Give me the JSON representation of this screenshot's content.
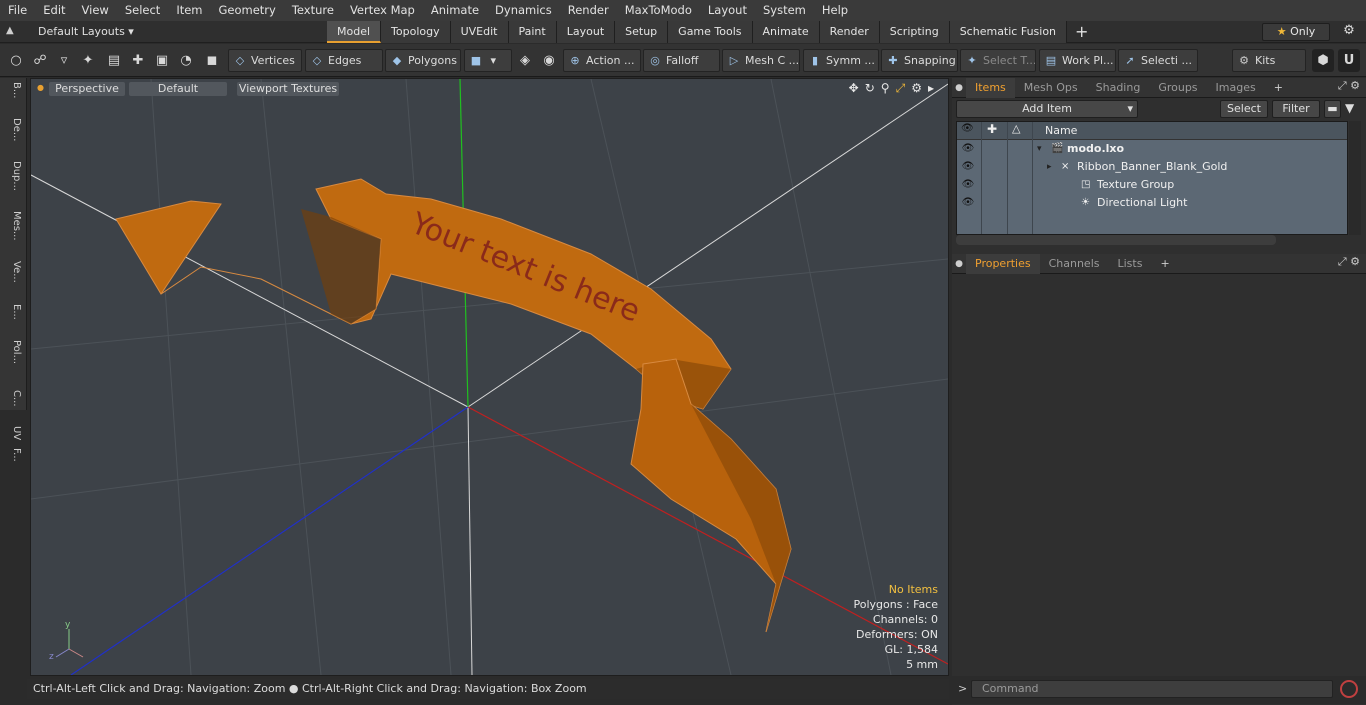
{
  "menu": [
    "File",
    "Edit",
    "View",
    "Select",
    "Item",
    "Geometry",
    "Texture",
    "Vertex Map",
    "Animate",
    "Dynamics",
    "Render",
    "MaxToModo",
    "Layout",
    "System",
    "Help"
  ],
  "layout": {
    "name": "Default Layouts ▾",
    "tabs": [
      "Model",
      "Topology",
      "UVEdit",
      "Paint",
      "Layout",
      "Setup",
      "Game Tools",
      "Animate",
      "Render",
      "Scripting",
      "Schematic Fusion"
    ],
    "active_tab": "Model",
    "plus": "+",
    "only_label": "Only"
  },
  "toolbar": {
    "vertices": "Vertices",
    "edges": "Edges",
    "polygons": "Polygons",
    "action": "Action",
    "falloff": "Falloff",
    "mesh": "Mesh C ...",
    "symm": "Symm ...",
    "snapping": "Snapping",
    "select_t": "Select T...",
    "work_pl": "Work Pl...",
    "selecti": "Selecti ...",
    "kits": "Kits"
  },
  "left_tabs": [
    "B...",
    "De...",
    "Dup...",
    "Mes...",
    "Ve...",
    "E...",
    "Pol...",
    "C...",
    "UV",
    "F..."
  ],
  "viewport": {
    "perspective": "Perspective",
    "default": "Default",
    "textures": "Viewport Textures",
    "banner_text": "Your text is here",
    "info": {
      "items": "No Items",
      "polygons": "Polygons : Face",
      "channels": "Channels: 0",
      "deformers": "Deformers: ON",
      "gl": "GL: 1,584",
      "scale": "5 mm"
    },
    "colors": {
      "ribbon": "#c06a10",
      "ribbon_dark": "#7a3f05",
      "text": "#8a2a1a",
      "axis_x": "#c02020",
      "axis_y": "#20c020",
      "axis_z": "#2020c0"
    }
  },
  "status": "Ctrl-Alt-Left Click and Drag: Navigation: Zoom ● Ctrl-Alt-Right Click and Drag: Navigation: Box Zoom",
  "items_panel": {
    "tabs": [
      "Items",
      "Mesh Ops",
      "Shading",
      "Groups",
      "Images"
    ],
    "active": "Items",
    "add_item": "Add Item",
    "select": "Select",
    "filter": "Filter",
    "name_header": "Name",
    "rows": [
      {
        "label": "modo.lxo",
        "arrow": "▾"
      },
      {
        "label": "Ribbon_Banner_Blank_Gold",
        "arrow": "▸"
      },
      {
        "label": "Texture Group",
        "arrow": ""
      },
      {
        "label": "Directional Light",
        "arrow": ""
      }
    ]
  },
  "props_panel": {
    "tabs": [
      "Properties",
      "Channels",
      "Lists"
    ],
    "active": "Properties"
  },
  "command": {
    "prompt": ">",
    "placeholder": "Command"
  }
}
